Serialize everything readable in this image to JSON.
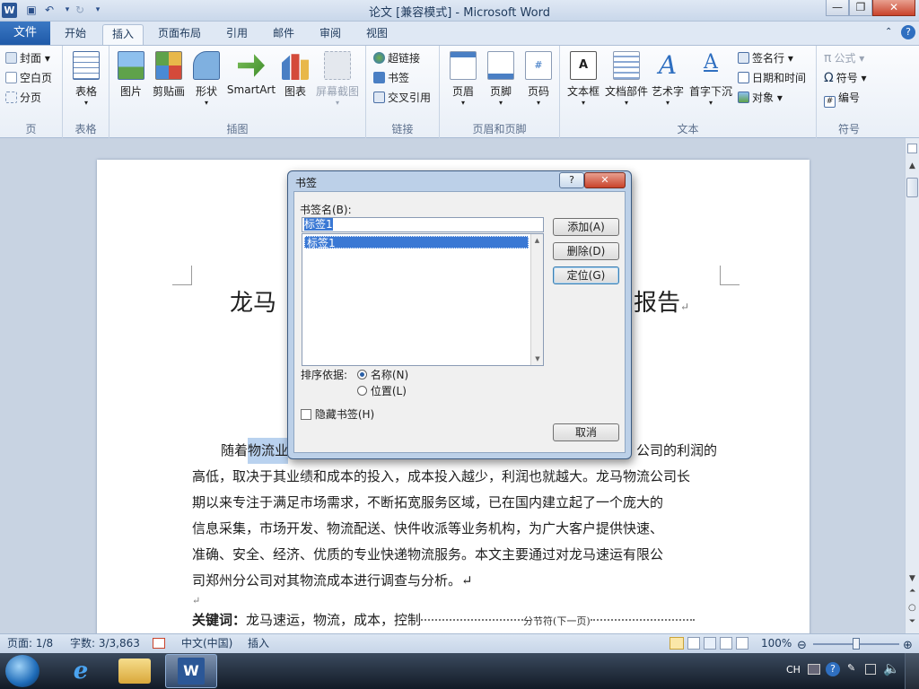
{
  "app": {
    "title": "论文 [兼容模式] - Microsoft Word",
    "qat_undo": "↶",
    "qat_redo": "↻"
  },
  "tabs": {
    "file": "文件",
    "items": [
      "开始",
      "插入",
      "页面布局",
      "引用",
      "邮件",
      "审阅",
      "视图"
    ],
    "active": "插入"
  },
  "ribbon": {
    "pages": {
      "label": "页",
      "cover": "封面",
      "blank": "空白页",
      "break": "分页"
    },
    "tables": {
      "label": "表格",
      "table": "表格"
    },
    "illustrations": {
      "label": "插图",
      "picture": "图片",
      "clipart": "剪贴画",
      "shapes": "形状",
      "smartart": "SmartArt",
      "chart": "图表",
      "screenshot": "屏幕截图"
    },
    "links": {
      "label": "链接",
      "hyperlink": "超链接",
      "bookmark": "书签",
      "crossref": "交叉引用"
    },
    "headerfooter": {
      "label": "页眉和页脚",
      "header": "页眉",
      "footer": "页脚",
      "pagenum": "页码"
    },
    "text": {
      "label": "文本",
      "textbox": "文本框",
      "quickparts": "文档部件",
      "wordart": "艺术字",
      "dropcap": "首字下沉",
      "sigline": "签名行",
      "datetime": "日期和时间",
      "object": "对象"
    },
    "symbols": {
      "label": "符号",
      "equation": "公式",
      "symbol": "符号",
      "number": "编号"
    }
  },
  "document": {
    "title_left": "龙马",
    "title_right": "报告",
    "para_lines": [
      "公司的利润的",
      "高低，取决于其业绩和成本的投入，成本投入越少，利润也就越大。龙马物流公司长",
      "期以来专注于满足市场需求，不断拓宽服务区域，已在国内建立起了一个庞大的",
      "信息采集，市场开发、物流配送、快件收派等业务机构，为广大客户提供快速、",
      "准确、安全、经济、优质的专业快递物流服务。本文主要通过对龙马速运有限公",
      "司郑州分公司对其物流成本进行调查与分析。↵"
    ],
    "para_start": "随着",
    "para_start_highlight": "物流业",
    "return_mark": "↵",
    "keywords_label": "关键词：",
    "keywords": "龙马速运，物流，成本，控制",
    "section_break": "分节符(下一页)"
  },
  "dialog": {
    "title": "书签",
    "name_label": "书签名(B):",
    "name_value": "标签1",
    "list_items": [
      "标签1"
    ],
    "add": "添加(A)",
    "delete": "删除(D)",
    "goto": "定位(G)",
    "sort_label": "排序依据:",
    "sort_name": "名称(N)",
    "sort_location": "位置(L)",
    "hidden": "隐藏书签(H)",
    "cancel": "取消",
    "help": "?",
    "close": "✕"
  },
  "status": {
    "page": "页面: 1/8",
    "words": "字数: 3/3,863",
    "lang": "中文(中国)",
    "mode": "插入",
    "zoom": "100%",
    "zoom_level": 0.5
  },
  "taskbar": {
    "lang": "CH"
  }
}
